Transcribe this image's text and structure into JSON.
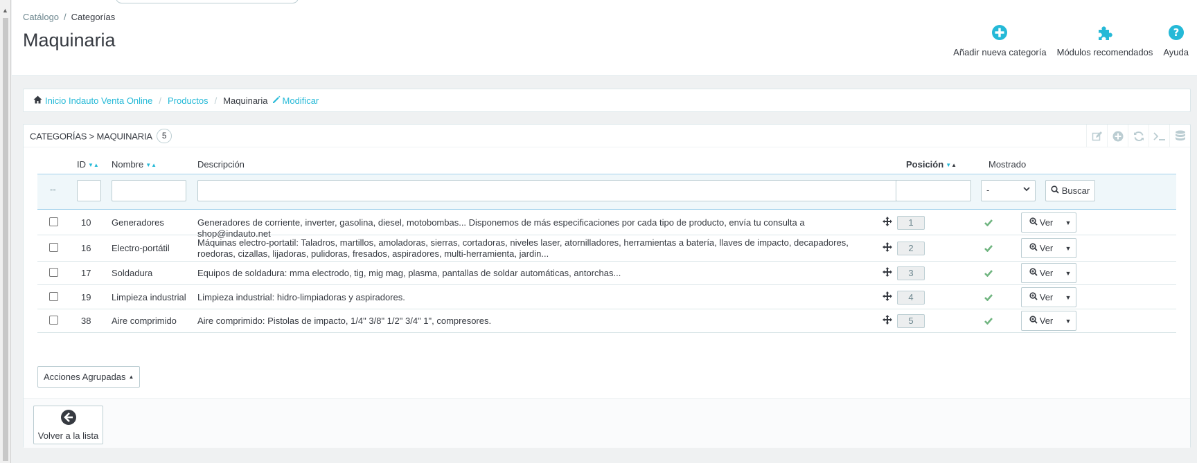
{
  "breadcrumb_top": {
    "parent": "Catálogo",
    "current": "Categorías"
  },
  "page_title": "Maquinaria",
  "toolbar": [
    {
      "label": "Añadir nueva categoría",
      "icon": "plus-circle-icon"
    },
    {
      "label": "Módulos recomendados",
      "icon": "puzzle-icon"
    },
    {
      "label": "Ayuda",
      "icon": "help-icon"
    }
  ],
  "category_breadcrumb": {
    "home": "Inicio Indauto Venta Online",
    "products": "Productos",
    "current": "Maquinaria",
    "edit": "Modificar"
  },
  "list": {
    "title": "Categorías > Maquinaria",
    "count": "5",
    "columns": {
      "id": "ID",
      "name": "Nombre",
      "description": "Descripción",
      "position": "Posición",
      "shown": "Mostrado"
    },
    "filter": {
      "dash": "--",
      "shown_select": "-",
      "search_label": "Buscar"
    },
    "rows": [
      {
        "id": "10",
        "name": "Generadores",
        "description": "Generadores de corriente, inverter, gasolina, diesel, motobombas... Disponemos de más especificaciones por cada tipo de producto, envía tu consulta a shop@indauto.net",
        "position": "1",
        "shown": true
      },
      {
        "id": "16",
        "name": "Electro-portátil",
        "description": "Máquinas electro-portatil: Taladros, martillos, amoladoras, sierras, cortadoras, niveles laser, atornilladores, herramientas a batería, llaves de impacto, decapadores, roedoras, cizallas, lijadoras, pulidoras, fresados, aspiradores, multi-herramienta, jardin...",
        "position": "2",
        "shown": true
      },
      {
        "id": "17",
        "name": "Soldadura",
        "description": "Equipos de soldadura: mma electrodo, tig, mig mag, plasma, pantallas de soldar automáticas, antorchas...",
        "position": "3",
        "shown": true
      },
      {
        "id": "19",
        "name": "Limpieza industrial",
        "description": "Limpieza industrial: hidro-limpiadoras y aspiradores.",
        "position": "4",
        "shown": true
      },
      {
        "id": "38",
        "name": "Aire comprimido",
        "description": "Aire comprimido: Pistolas de impacto, 1/4\" 3/8\" 1/2\" 3/4\" 1\", compresores.",
        "position": "5",
        "shown": true
      }
    ],
    "view_label": "Ver",
    "bulk_actions_label": "Acciones Agrupadas",
    "back_label": "Volver a la lista"
  },
  "colors": {
    "accent": "#25b9d7",
    "check": "#70b580",
    "text": "#363a41"
  }
}
